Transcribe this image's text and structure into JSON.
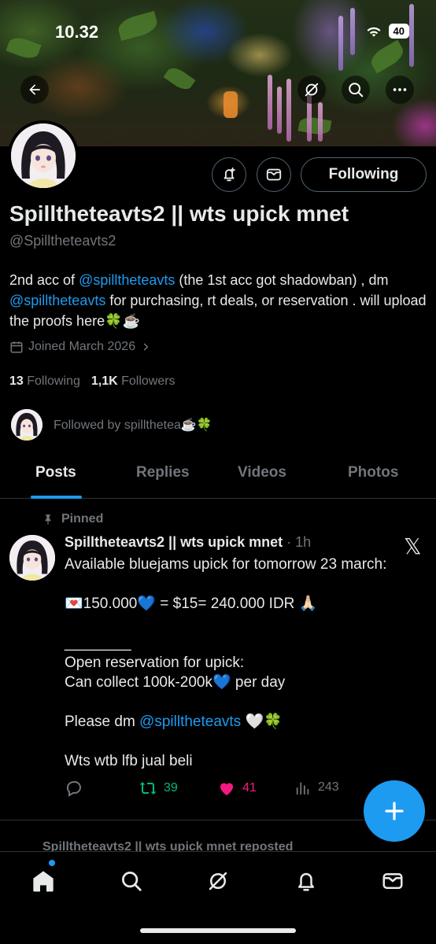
{
  "status_bar": {
    "time": "10.32",
    "battery": "40"
  },
  "profile": {
    "name": "Spilltheteavts2 || wts upick mnet",
    "handle": "@Spilltheteavts2",
    "following_button": "Following",
    "bio": {
      "p1": "2nd acc of ",
      "link1": "@spilltheteavts",
      "p2": " (the 1st acc got shadowban) , dm ",
      "link2": "@spilltheteavts",
      "p3": " for purchasing, rt deals, or reservation . will upload the proofs here🍀☕"
    },
    "joined": "Joined March 2026",
    "following_count": "13",
    "following_label": "Following",
    "followers_count": "1,1K",
    "followers_label": "Followers",
    "followed_by": "Followed by spillthetea☕🍀"
  },
  "tabs": [
    "Posts",
    "Replies",
    "Videos",
    "Photos"
  ],
  "post": {
    "pinned_label": "Pinned",
    "author": "Spilltheteavts2 || wts upick mnet",
    "time": " · 1h",
    "lines": {
      "l1": "Available bluejams upick for tomorrow 23 march:",
      "l2": "💌150.000💙 = $15= 240.000 IDR 🙏🏻",
      "l3": "________",
      "l4": "Open reservation for upick:",
      "l5": "Can collect 100k-200k💙 per day",
      "l6_a": "Please dm ",
      "l6_link": "@spilltheteavts",
      "l6_b": " 🤍🍀",
      "l7": "Wts wtb lfb jual beli"
    },
    "stats": {
      "reposts": "39",
      "likes": "41",
      "views": "243"
    }
  },
  "next_item": {
    "reposted_label": "Spilltheteavts2 || wts upick mnet reposted"
  },
  "colors": {
    "accent": "#1d9bf0",
    "like": "#f91880",
    "repost": "#00ba7c",
    "muted": "#71767b"
  },
  "icons": [
    "back-arrow-icon",
    "grok-icon",
    "search-icon",
    "more-icon",
    "notify-bell-plus-icon",
    "message-icon",
    "calendar-icon",
    "chevron-right-icon",
    "pin-icon",
    "reply-icon",
    "repost-icon",
    "heart-icon",
    "views-icon",
    "compose-plus-icon",
    "home-icon",
    "bell-icon",
    "mail-icon"
  ]
}
